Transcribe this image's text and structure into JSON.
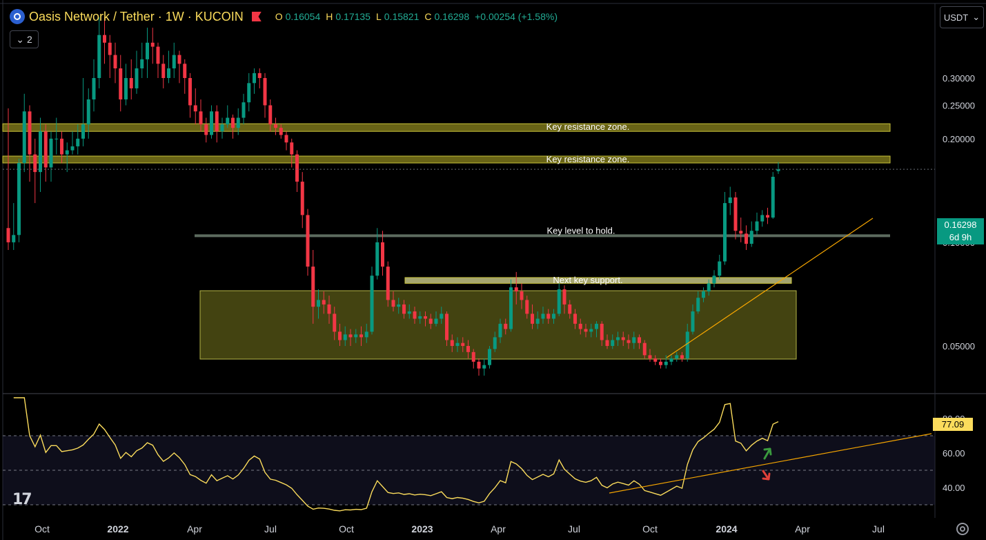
{
  "header": {
    "title": "Oasis Network / Tether · 1W · KUCOIN",
    "ohlc": [
      {
        "key": "O",
        "value": "0.16054"
      },
      {
        "key": "H",
        "value": "0.17135"
      },
      {
        "key": "L",
        "value": "0.15821"
      },
      {
        "key": "C",
        "value": "0.16298"
      }
    ],
    "change": "+0.00254 (+1.58%)",
    "collapse_count": "2",
    "currency": "USDT"
  },
  "price_tag": {
    "value": "0.16298",
    "countdown": "6d 9h"
  },
  "rsi_tag": {
    "value": "77.09"
  },
  "colors": {
    "up": "#089981",
    "down": "#f23645",
    "rsi": "#fbdc5c",
    "trend": "#f7a600",
    "zone": "#cfcf35"
  },
  "chart_data": {
    "type": "candlestick",
    "price_axis": {
      "scale": "log",
      "ticks": [
        "0.30000",
        "0.25000",
        "0.20000",
        "0.10000",
        "0.05000"
      ],
      "tick_values": [
        0.3,
        0.25,
        0.2,
        0.1,
        0.05
      ]
    },
    "time_axis": {
      "labels": [
        "Oct",
        "2022",
        "Apr",
        "Jul",
        "Oct",
        "2023",
        "Apr",
        "Jul",
        "Oct",
        "2024",
        "Apr",
        "Jul"
      ]
    },
    "annotations": [
      {
        "label": "Key resistance zone.",
        "kind": "zone",
        "price_low": 0.21,
        "price_high": 0.221
      },
      {
        "label": "Key resistance zone.",
        "kind": "zone",
        "price_low": 0.17,
        "price_high": 0.178
      },
      {
        "label": "Key level to hold.",
        "kind": "line",
        "price": 0.1045
      },
      {
        "label": "Next key support.",
        "kind": "zone",
        "price_low": 0.076,
        "price_high": 0.079
      }
    ],
    "rsi": {
      "ticks": [
        "80.00",
        "60.00",
        "40.00"
      ],
      "tick_values": [
        80,
        60,
        40
      ],
      "current": 77.09,
      "bands": [
        70,
        50,
        30
      ]
    },
    "candles": [
      [
        0.11,
        0.1,
        0.245,
        0.095
      ],
      [
        0.1,
        0.105,
        0.13,
        0.095
      ],
      [
        0.105,
        0.17,
        0.175,
        0.1
      ],
      [
        0.17,
        0.24,
        0.27,
        0.16
      ],
      [
        0.24,
        0.18,
        0.25,
        0.15
      ],
      [
        0.18,
        0.16,
        0.2,
        0.13
      ],
      [
        0.16,
        0.21,
        0.23,
        0.14
      ],
      [
        0.21,
        0.165,
        0.22,
        0.15
      ],
      [
        0.165,
        0.2,
        0.21,
        0.15
      ],
      [
        0.2,
        0.2,
        0.23,
        0.18
      ],
      [
        0.2,
        0.18,
        0.21,
        0.17
      ],
      [
        0.18,
        0.185,
        0.195,
        0.16
      ],
      [
        0.185,
        0.19,
        0.21,
        0.18
      ],
      [
        0.19,
        0.2,
        0.22,
        0.18
      ],
      [
        0.2,
        0.22,
        0.3,
        0.19
      ],
      [
        0.22,
        0.26,
        0.28,
        0.2
      ],
      [
        0.26,
        0.3,
        0.34,
        0.24
      ],
      [
        0.3,
        0.4,
        0.45,
        0.28
      ],
      [
        0.4,
        0.38,
        0.45,
        0.33
      ],
      [
        0.38,
        0.35,
        0.4,
        0.3
      ],
      [
        0.35,
        0.32,
        0.38,
        0.29
      ],
      [
        0.32,
        0.26,
        0.35,
        0.24
      ],
      [
        0.26,
        0.3,
        0.33,
        0.25
      ],
      [
        0.3,
        0.28,
        0.34,
        0.26
      ],
      [
        0.28,
        0.32,
        0.36,
        0.27
      ],
      [
        0.32,
        0.34,
        0.38,
        0.3
      ],
      [
        0.34,
        0.38,
        0.42,
        0.3
      ],
      [
        0.38,
        0.37,
        0.42,
        0.33
      ],
      [
        0.37,
        0.33,
        0.38,
        0.3
      ],
      [
        0.33,
        0.3,
        0.35,
        0.28
      ],
      [
        0.3,
        0.32,
        0.36,
        0.29
      ],
      [
        0.32,
        0.35,
        0.38,
        0.3
      ],
      [
        0.35,
        0.33,
        0.36,
        0.29
      ],
      [
        0.33,
        0.3,
        0.34,
        0.27
      ],
      [
        0.3,
        0.25,
        0.31,
        0.23
      ],
      [
        0.25,
        0.24,
        0.28,
        0.22
      ],
      [
        0.24,
        0.22,
        0.26,
        0.21
      ],
      [
        0.22,
        0.205,
        0.23,
        0.195
      ],
      [
        0.205,
        0.24,
        0.25,
        0.2
      ],
      [
        0.24,
        0.21,
        0.25,
        0.195
      ],
      [
        0.21,
        0.22,
        0.23,
        0.2
      ],
      [
        0.22,
        0.23,
        0.25,
        0.215
      ],
      [
        0.23,
        0.215,
        0.235,
        0.2
      ],
      [
        0.215,
        0.23,
        0.245,
        0.205
      ],
      [
        0.23,
        0.255,
        0.27,
        0.22
      ],
      [
        0.255,
        0.29,
        0.31,
        0.24
      ],
      [
        0.29,
        0.31,
        0.32,
        0.27
      ],
      [
        0.31,
        0.3,
        0.32,
        0.28
      ],
      [
        0.3,
        0.25,
        0.31,
        0.23
      ],
      [
        0.25,
        0.22,
        0.26,
        0.21
      ],
      [
        0.22,
        0.215,
        0.23,
        0.205
      ],
      [
        0.215,
        0.205,
        0.22,
        0.2
      ],
      [
        0.205,
        0.195,
        0.21,
        0.185
      ],
      [
        0.195,
        0.18,
        0.2,
        0.165
      ],
      [
        0.18,
        0.15,
        0.185,
        0.14
      ],
      [
        0.15,
        0.12,
        0.16,
        0.11
      ],
      [
        0.12,
        0.085,
        0.125,
        0.08
      ],
      [
        0.085,
        0.065,
        0.095,
        0.058
      ],
      [
        0.065,
        0.068,
        0.073,
        0.06
      ],
      [
        0.068,
        0.066,
        0.072,
        0.062
      ],
      [
        0.066,
        0.062,
        0.07,
        0.058
      ],
      [
        0.062,
        0.055,
        0.065,
        0.052
      ],
      [
        0.055,
        0.052,
        0.058,
        0.05
      ],
      [
        0.052,
        0.054,
        0.057,
        0.05
      ],
      [
        0.054,
        0.053,
        0.056,
        0.05
      ],
      [
        0.053,
        0.054,
        0.056,
        0.051
      ],
      [
        0.054,
        0.053,
        0.057,
        0.05
      ],
      [
        0.053,
        0.055,
        0.058,
        0.051
      ],
      [
        0.055,
        0.08,
        0.085,
        0.054
      ],
      [
        0.08,
        0.1,
        0.11,
        0.078
      ],
      [
        0.1,
        0.085,
        0.108,
        0.08
      ],
      [
        0.085,
        0.068,
        0.088,
        0.065
      ],
      [
        0.068,
        0.065,
        0.072,
        0.063
      ],
      [
        0.065,
        0.066,
        0.069,
        0.062
      ],
      [
        0.066,
        0.062,
        0.068,
        0.06
      ],
      [
        0.062,
        0.063,
        0.066,
        0.06
      ],
      [
        0.063,
        0.06,
        0.065,
        0.058
      ],
      [
        0.06,
        0.061,
        0.063,
        0.058
      ],
      [
        0.061,
        0.06,
        0.063,
        0.057
      ],
      [
        0.06,
        0.058,
        0.062,
        0.056
      ],
      [
        0.058,
        0.06,
        0.063,
        0.057
      ],
      [
        0.06,
        0.062,
        0.065,
        0.058
      ],
      [
        0.062,
        0.052,
        0.063,
        0.05
      ],
      [
        0.052,
        0.05,
        0.054,
        0.048
      ],
      [
        0.05,
        0.051,
        0.053,
        0.048
      ],
      [
        0.051,
        0.05,
        0.053,
        0.048
      ],
      [
        0.05,
        0.048,
        0.052,
        0.046
      ],
      [
        0.048,
        0.045,
        0.049,
        0.043
      ],
      [
        0.045,
        0.043,
        0.046,
        0.041
      ],
      [
        0.043,
        0.044,
        0.046,
        0.041
      ],
      [
        0.044,
        0.049,
        0.05,
        0.043
      ],
      [
        0.049,
        0.053,
        0.055,
        0.048
      ],
      [
        0.053,
        0.058,
        0.06,
        0.051
      ],
      [
        0.058,
        0.056,
        0.06,
        0.054
      ],
      [
        0.056,
        0.074,
        0.078,
        0.055
      ],
      [
        0.074,
        0.072,
        0.082,
        0.066
      ],
      [
        0.072,
        0.068,
        0.076,
        0.064
      ],
      [
        0.068,
        0.062,
        0.07,
        0.06
      ],
      [
        0.062,
        0.058,
        0.066,
        0.056
      ],
      [
        0.058,
        0.06,
        0.063,
        0.056
      ],
      [
        0.06,
        0.062,
        0.065,
        0.058
      ],
      [
        0.062,
        0.06,
        0.064,
        0.058
      ],
      [
        0.06,
        0.062,
        0.064,
        0.058
      ],
      [
        0.062,
        0.073,
        0.076,
        0.061
      ],
      [
        0.073,
        0.066,
        0.075,
        0.062
      ],
      [
        0.066,
        0.062,
        0.068,
        0.06
      ],
      [
        0.062,
        0.058,
        0.064,
        0.056
      ],
      [
        0.058,
        0.056,
        0.06,
        0.054
      ],
      [
        0.056,
        0.055,
        0.058,
        0.053
      ],
      [
        0.055,
        0.056,
        0.058,
        0.053
      ],
      [
        0.056,
        0.058,
        0.059,
        0.053
      ],
      [
        0.058,
        0.052,
        0.059,
        0.05
      ],
      [
        0.052,
        0.05,
        0.054,
        0.049
      ],
      [
        0.05,
        0.052,
        0.054,
        0.049
      ],
      [
        0.052,
        0.053,
        0.055,
        0.05
      ],
      [
        0.053,
        0.052,
        0.055,
        0.05
      ],
      [
        0.052,
        0.051,
        0.054,
        0.049
      ],
      [
        0.051,
        0.053,
        0.055,
        0.049
      ],
      [
        0.053,
        0.051,
        0.054,
        0.049
      ],
      [
        0.051,
        0.047,
        0.052,
        0.046
      ],
      [
        0.047,
        0.046,
        0.049,
        0.045
      ],
      [
        0.046,
        0.045,
        0.047,
        0.044
      ],
      [
        0.045,
        0.044,
        0.046,
        0.043
      ],
      [
        0.044,
        0.045,
        0.047,
        0.043
      ],
      [
        0.045,
        0.046,
        0.047,
        0.044
      ],
      [
        0.046,
        0.047,
        0.048,
        0.045
      ],
      [
        0.047,
        0.046,
        0.048,
        0.045
      ],
      [
        0.046,
        0.055,
        0.058,
        0.045
      ],
      [
        0.055,
        0.063,
        0.066,
        0.054
      ],
      [
        0.063,
        0.069,
        0.072,
        0.062
      ],
      [
        0.069,
        0.072,
        0.074,
        0.067
      ],
      [
        0.072,
        0.076,
        0.078,
        0.07
      ],
      [
        0.076,
        0.08,
        0.083,
        0.074
      ],
      [
        0.08,
        0.088,
        0.092,
        0.078
      ],
      [
        0.088,
        0.13,
        0.14,
        0.086
      ],
      [
        0.13,
        0.135,
        0.145,
        0.12
      ],
      [
        0.135,
        0.108,
        0.14,
        0.102
      ],
      [
        0.108,
        0.106,
        0.118,
        0.1
      ],
      [
        0.106,
        0.099,
        0.112,
        0.095
      ],
      [
        0.099,
        0.108,
        0.115,
        0.097
      ],
      [
        0.108,
        0.115,
        0.122,
        0.105
      ],
      [
        0.115,
        0.12,
        0.124,
        0.111
      ],
      [
        0.12,
        0.118,
        0.126,
        0.113
      ],
      [
        0.118,
        0.155,
        0.16,
        0.117
      ],
      [
        0.161,
        0.163,
        0.171,
        0.158
      ]
    ]
  }
}
